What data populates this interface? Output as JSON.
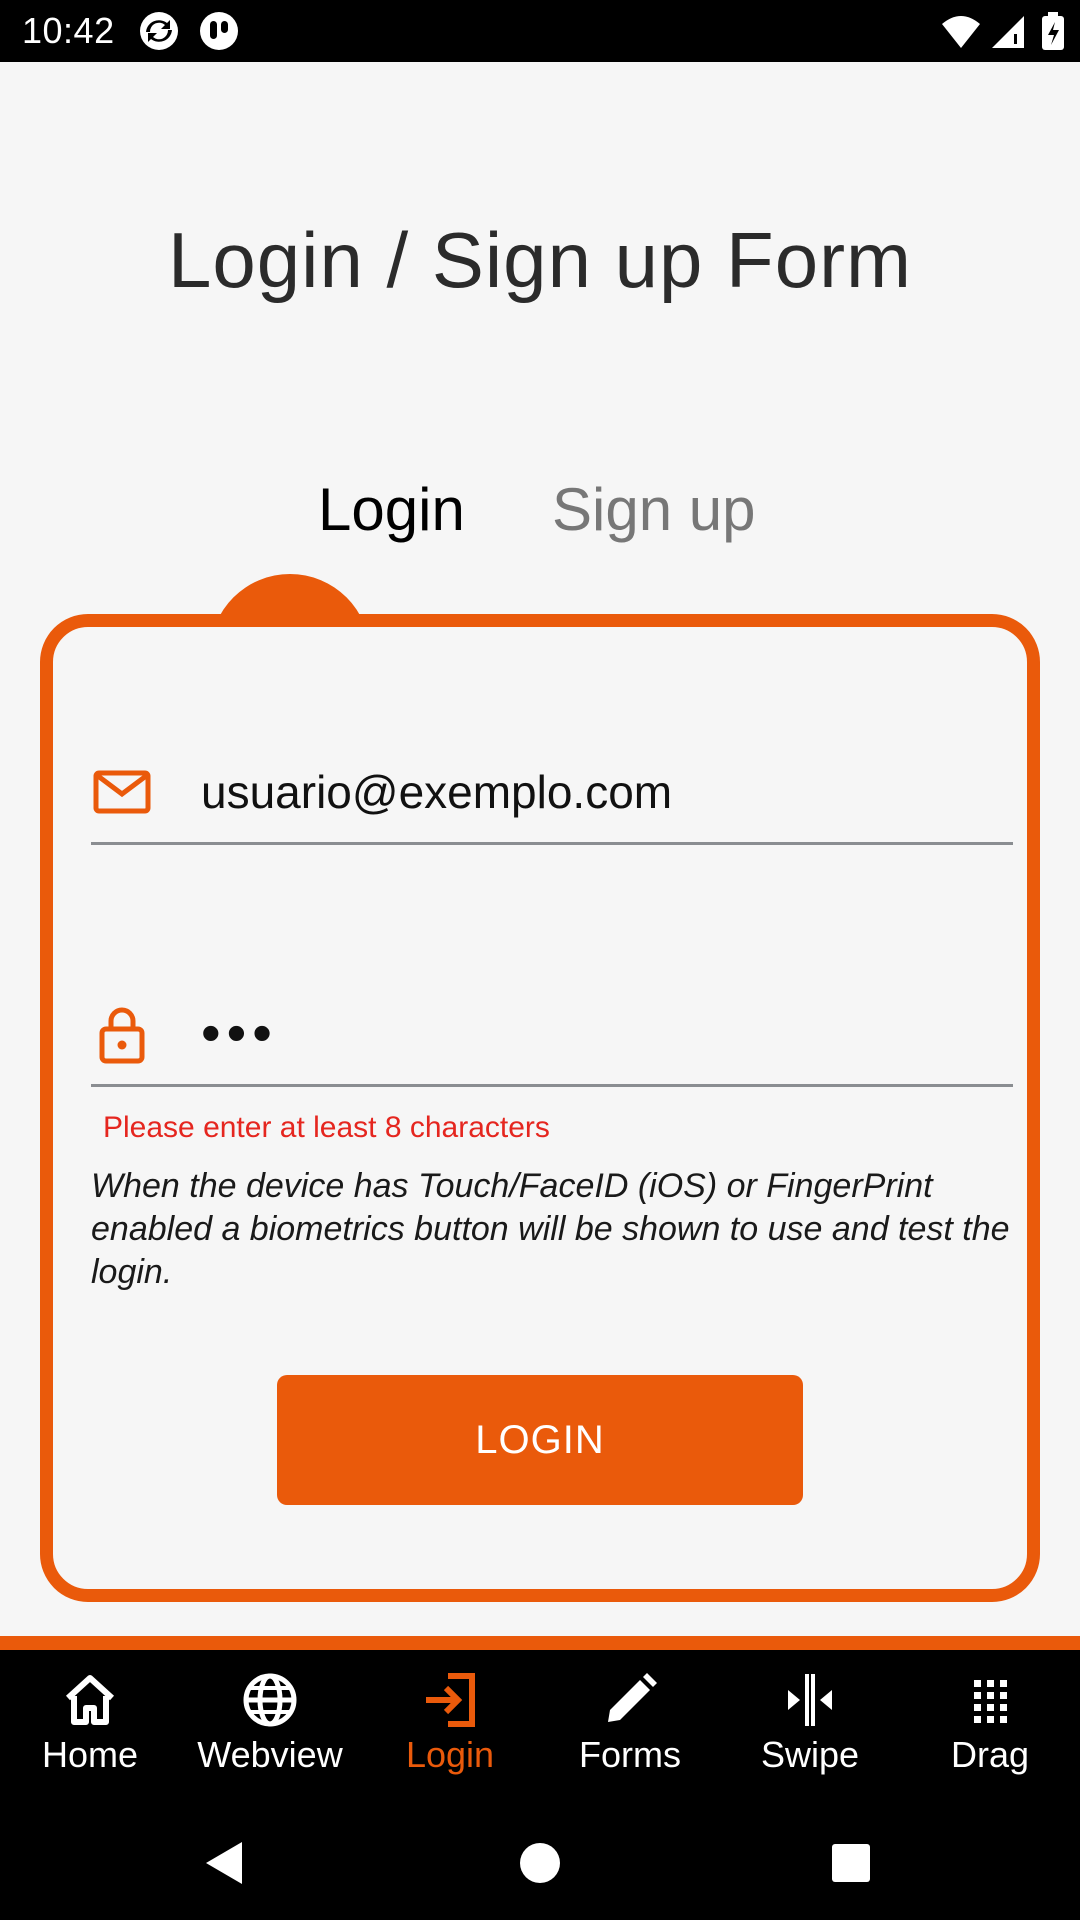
{
  "status_bar": {
    "time": "10:42"
  },
  "page": {
    "title": "Login / Sign up Form"
  },
  "tabs": [
    {
      "label": "Login"
    },
    {
      "label": "Sign up"
    }
  ],
  "form": {
    "email": {
      "value": "usuario@exemplo.com",
      "icon": "mail-icon"
    },
    "password": {
      "value": "•••",
      "icon": "lock-icon"
    },
    "error": "Please enter at least 8 characters",
    "help": "When the device has Touch/FaceID (iOS) or FingerPrint enabled a biometrics button will be shown to use and test the login.",
    "submit_label": "LOGIN"
  },
  "bottom_nav": {
    "items": [
      {
        "label": "Home",
        "icon": "home-icon"
      },
      {
        "label": "Webview",
        "icon": "globe-icon"
      },
      {
        "label": "Login",
        "icon": "login-icon",
        "active": true
      },
      {
        "label": "Forms",
        "icon": "pencil-icon"
      },
      {
        "label": "Swipe",
        "icon": "swipe-icon"
      },
      {
        "label": "Drag",
        "icon": "grid-icon"
      }
    ]
  },
  "colors": {
    "accent": "#ea5a0b",
    "error": "#e5261f"
  }
}
